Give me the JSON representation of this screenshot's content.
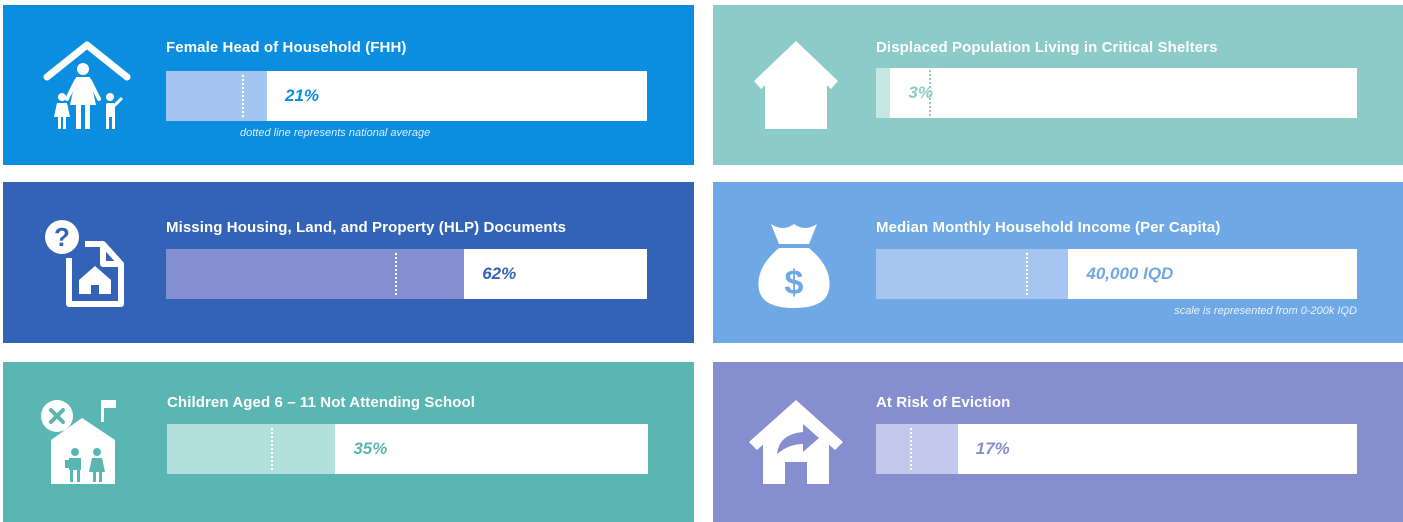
{
  "cards": [
    {
      "title": "Female Head of Household (FHH)",
      "value_label": "21%",
      "percent": 21,
      "note": "dotted line represents national average",
      "icon": "family-home-icon",
      "colors": {
        "background": "#0b8de0",
        "fill": "#a4c4f2",
        "value": "#0b8de0"
      }
    },
    {
      "title": "Displaced Population Living in Critical Shelters",
      "value_label": "3%",
      "percent": 3,
      "icon": "house-icon",
      "colors": {
        "background": "#8ccbc8",
        "fill": "#c6e6e3",
        "value": "#8ccbc8"
      }
    },
    {
      "title": "Missing Housing, Land, and Property (HLP) Documents",
      "value_label": "62%",
      "percent": 62,
      "icon": "document-house-question-icon",
      "colors": {
        "background": "#3263b7",
        "fill": "#838fd0",
        "value": "#3263b7"
      }
    },
    {
      "title": "Median Monthly Household Income (Per Capita)",
      "value_label": "40,000 IQD",
      "percent": 40,
      "note": "scale is represented from 0-200k IQD",
      "icon": "money-bag-icon",
      "colors": {
        "background": "#6ea9e6",
        "fill": "#a7c5f1",
        "value": "#6ea9e6"
      }
    },
    {
      "title": "Children Aged 6 – 11 Not Attending School",
      "value_label": "35%",
      "percent": 35,
      "icon": "school-children-icon",
      "colors": {
        "background": "#59b6b2",
        "fill": "#b3dfdc",
        "value": "#59b6b2"
      }
    },
    {
      "title": "At Risk of Eviction",
      "value_label": "17%",
      "percent": 17,
      "icon": "house-eviction-icon",
      "colors": {
        "background": "#858ecf",
        "fill": "#c4c7ec",
        "value": "#858ecf"
      }
    }
  ]
}
